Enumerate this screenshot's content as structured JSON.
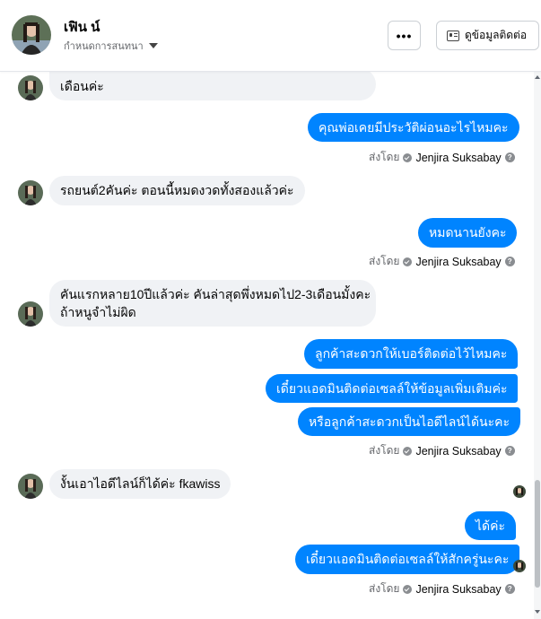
{
  "header": {
    "name": "เฟิน น์",
    "subtitle": "กำหนดการสนทนา",
    "more_label": "•••",
    "contact_label": "ดูข้อมูลติดต่อ"
  },
  "messages": {
    "m0": "เดือนค่ะ",
    "m1": "คุณพ่อเคยมีประวัติผ่อนอะไรไหมคะ",
    "m2": "รถยนต์2คันค่ะ ตอนนี้หมดงวดทั้งสองแล้วค่ะ",
    "m3": "หมดนานยังคะ",
    "m4_line1": "คันแรกหลาย10ปีแล้วค่ะ คันล่าสุดพึ่งหมดไป2-3เดือนมั้งคะ",
    "m4_line2": "ถ้าหนูจำไม่ผิด",
    "m5": "ลูกค้าสะดวกให้เบอร์ติดต่อไว้ไหมคะ",
    "m6": "เดี๋ยวแอดมินติดต่อเซลล์ให้ข้อมูลเพิ่มเติมค่ะ",
    "m7": "หรือลูกค้าสะดวกเป็นไอดีไลน์ได้นะคะ",
    "m8": "งั้นเอาไอดีไลน์ก็ได้ค่ะ fkawiss",
    "m9": "ได้ค่ะ",
    "m10": "เดี๋ยวแอดมินติดต่อเซลล์ให้สักครู่นะคะ"
  },
  "sent_by": {
    "prefix": "ส่งโดย",
    "name": "Jenjira Suksabay",
    "help": "?"
  },
  "colors": {
    "outgoing_bubble": "#0084ff",
    "incoming_bubble": "#f0f2f5",
    "meta_text": "#65676b"
  },
  "icons": {
    "more": "more-dots-icon",
    "contact": "contact-card-icon",
    "verified": "check-circle-icon",
    "help": "help-circle-icon",
    "dropdown": "caret-down-icon"
  }
}
